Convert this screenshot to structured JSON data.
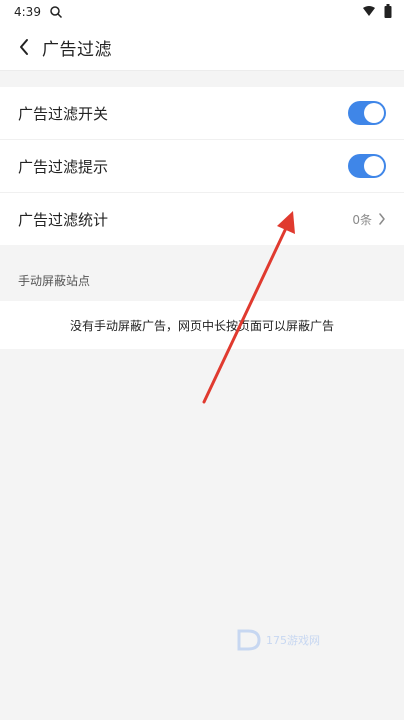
{
  "status_bar": {
    "time": "4:39"
  },
  "header": {
    "title": "广告过滤"
  },
  "settings": {
    "items": [
      {
        "label": "广告过滤开关",
        "control": "toggle",
        "enabled": true
      },
      {
        "label": "广告过滤提示",
        "control": "toggle",
        "enabled": true
      },
      {
        "label": "广告过滤统计",
        "value": "0条"
      }
    ]
  },
  "manual_section": {
    "title": "手动屏蔽站点",
    "empty_text": "没有手动屏蔽广告，网页中长按页面可以屏蔽广告"
  },
  "watermark": {
    "text": "175游戏网"
  },
  "colors": {
    "toggle_on": "#3f86e8",
    "annotation_arrow": "#e03a2f"
  },
  "icons": {
    "search": "search-icon",
    "wifi": "wifi-icon",
    "battery": "battery-icon",
    "back": "back-chevron-icon",
    "chevron_right": "chevron-right-icon"
  }
}
